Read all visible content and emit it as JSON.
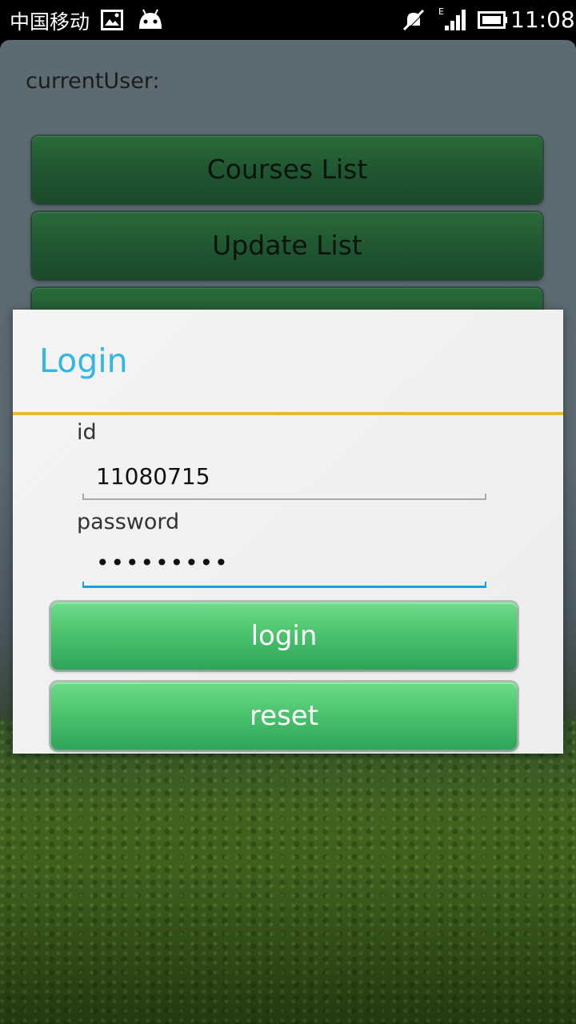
{
  "status_bar": {
    "carrier": "中国移动",
    "time": "11:08",
    "network_type": "E",
    "icons": [
      "image-icon",
      "android-icon",
      "mute-icon",
      "signal-icon",
      "battery-icon"
    ]
  },
  "main": {
    "current_user_label": "currentUser:",
    "buttons": [
      {
        "label": "Courses List"
      },
      {
        "label": "Update List"
      },
      {
        "label": ""
      }
    ]
  },
  "dialog": {
    "title": "Login",
    "id_label": "id",
    "id_value": "11080715",
    "password_label": "password",
    "password_value": "•••••••••",
    "login_label": "login",
    "reset_label": "reset"
  },
  "colors": {
    "title_accent": "#33b5e5",
    "divider": "#f0b43a",
    "focus_underline": "#1f9fd8",
    "dialog_button": "#4cc46e",
    "menu_button": "#1f5530"
  }
}
